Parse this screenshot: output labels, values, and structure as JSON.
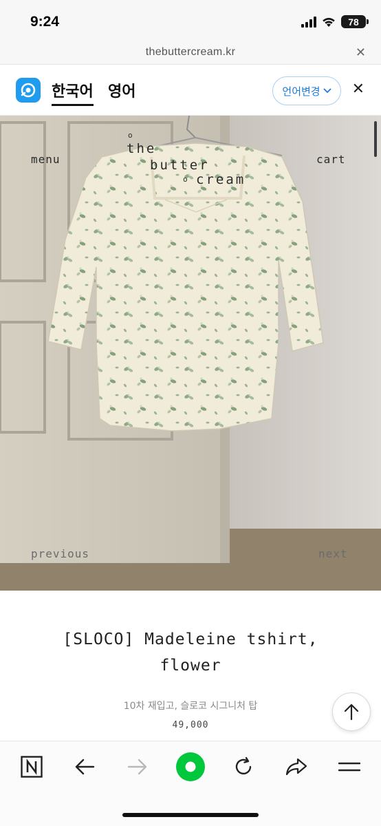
{
  "status": {
    "time": "9:24",
    "battery": "78"
  },
  "browser": {
    "url": "thebuttercream.kr"
  },
  "translate": {
    "tabs": [
      {
        "label": "한국어"
      },
      {
        "label": "영어"
      }
    ],
    "change_lang_label": "언어변경"
  },
  "site": {
    "menu": "menu",
    "cart": "cart",
    "logo": {
      "line1": "the",
      "line2": "butter",
      "line3": "cream"
    },
    "previous": "previous",
    "next": "next"
  },
  "product": {
    "title_line1": "[SLOCO] Madeleine tshirt,",
    "title_line2": "flower",
    "subtitle": "10차 재입고, 슬로코 시그니처 탑",
    "price": "49,000"
  },
  "colors": {
    "accent": "#1f9bf0",
    "naver_green": "#00c73c"
  }
}
